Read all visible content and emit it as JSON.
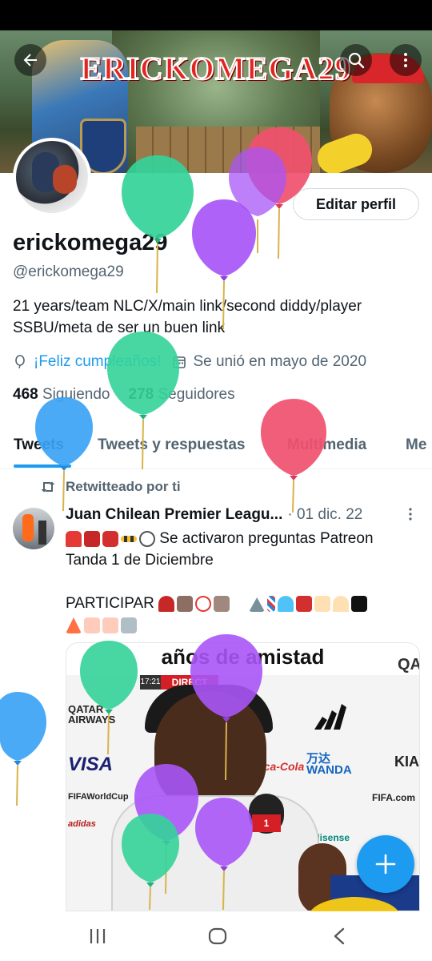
{
  "banner": {
    "title": "ERICKOMEGA29"
  },
  "profile": {
    "edit_button": "Editar perfil",
    "display_name": "erickomega29",
    "handle": "@erickomega29",
    "bio": "21 years/team NLC/X/main link/second diddy/player SSBU/meta de ser un buen link",
    "birthday": "¡Feliz cumpleaños!",
    "joined": "Se unió en mayo de 2020",
    "following_count": "468",
    "following_label": "Siguiendo",
    "followers_count": "278",
    "followers_label": "Seguidores"
  },
  "tabs": [
    {
      "label": "Tweets",
      "active": true
    },
    {
      "label": "Tweets y respuestas",
      "active": false
    },
    {
      "label": "Multimedia",
      "active": false
    },
    {
      "label": "Me",
      "active": false
    }
  ],
  "tweet": {
    "retweet_label": "Retwitteado por ti",
    "author": "Juan Chilean Premier Leagu...",
    "date": "· 01 dic. 22",
    "line1": "Se activaron preguntas Patreon",
    "line2": "Tanda 1 de Diciembre",
    "line3": "PARTICIPAR",
    "media": {
      "caption": "años de amistad",
      "live_badge": "DIRECT",
      "timestamp": "17:21",
      "mic_flag": "1",
      "sponsors": [
        "QATAR AIRWAYS",
        "VISA",
        "FIFAWorldCup",
        "adidas",
        "Coca-Cola",
        "万达 WANDA",
        "FIFA.com",
        "Hisense",
        "KIA",
        "QA"
      ]
    }
  },
  "icons": {
    "back": "arrow-left-icon",
    "search": "search-icon",
    "more": "more-vertical-icon",
    "birthday": "balloon-icon",
    "calendar": "calendar-icon",
    "retweet": "retweet-icon",
    "compose": "plus-icon"
  },
  "colors": {
    "accent": "#1d9bf0",
    "text_primary": "#0f1419",
    "text_secondary": "#536471"
  }
}
